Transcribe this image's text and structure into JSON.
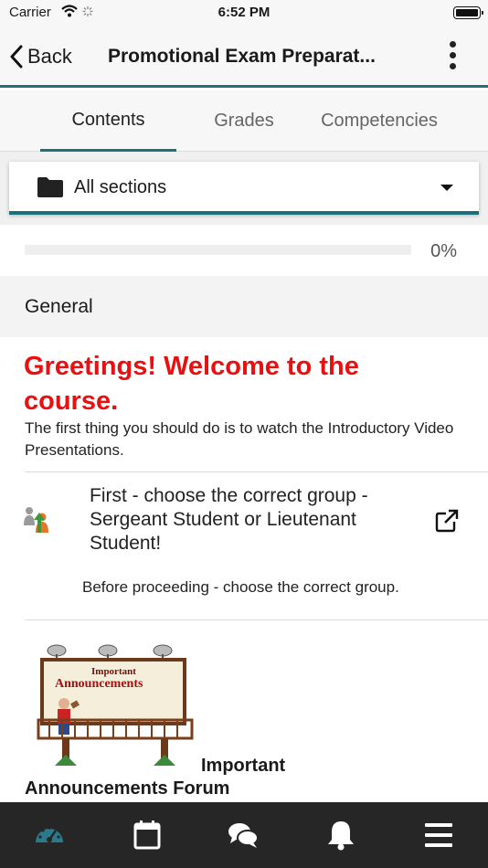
{
  "status_bar": {
    "carrier": "Carrier",
    "time": "6:52 PM"
  },
  "nav": {
    "back_label": "Back",
    "title": "Promotional Exam Preparat..."
  },
  "tabs": [
    {
      "label": "Contents",
      "active": true
    },
    {
      "label": "Grades",
      "active": false
    },
    {
      "label": "Competencies",
      "active": false
    }
  ],
  "section_selector": {
    "value": "All sections",
    "icon": "folder-icon"
  },
  "progress": {
    "value": 0,
    "label": "0%"
  },
  "section": {
    "title": "General",
    "greeting": "Greetings! Welcome to the course.",
    "intro": "The first thing you should do is to watch the Introductory Video Presentations.",
    "group_activity": {
      "title": "First - choose the correct group - Sergeant Student or Lieutenant Student!",
      "description": "Before proceeding - choose the correct group."
    },
    "announcements": {
      "image_text_1": "Important",
      "image_text_2": "Announcements",
      "title_line_1": "Important",
      "title_line_2": "Announcements Forum"
    }
  },
  "bottom_tabs": [
    {
      "icon": "dashboard-icon",
      "active": true
    },
    {
      "icon": "calendar-icon",
      "active": false
    },
    {
      "icon": "messages-icon",
      "active": false
    },
    {
      "icon": "notifications-bell-icon",
      "active": false
    },
    {
      "icon": "menu-icon",
      "active": false
    }
  ],
  "colors": {
    "accent": "#1d6f7a",
    "greeting": "#e81010",
    "tab_bar": "#262626",
    "active_tab_icon": "#2a7a8c"
  }
}
